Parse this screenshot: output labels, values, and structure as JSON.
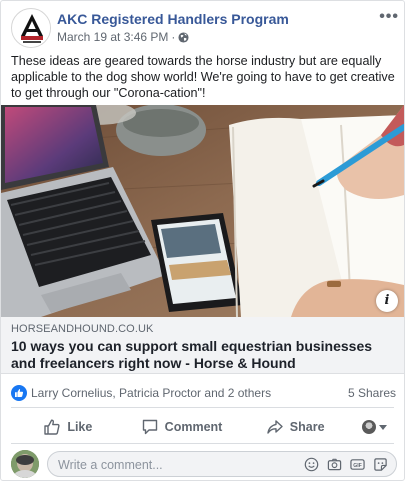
{
  "post": {
    "author": "AKC Registered Handlers Program",
    "timestamp": "March 19 at 3:46 PM",
    "separator": "·",
    "more_label": "•••",
    "text": "These ideas are geared towards the horse industry but are equally applicable to the dog show world! We're going to have to get creative to get through our \"Corona-cation\"!"
  },
  "link": {
    "domain": "HORSEANDHOUND.CO.UK",
    "title": "10 ways you can support small equestrian businesses and freelancers right now - Horse & Hound",
    "info_label": "i"
  },
  "reactions": {
    "names": "Larry Cornelius, Patricia Proctor and 2 others",
    "shares": "5 Shares"
  },
  "actions": {
    "like": "Like",
    "comment": "Comment",
    "share": "Share"
  },
  "comment": {
    "placeholder": "Write a comment..."
  },
  "icons": {
    "avatar": "akc-logo-icon",
    "privacy": "globe-icon",
    "reaction": "like-reaction-icon",
    "like": "thumbs-up-icon",
    "comment": "speech-bubble-icon",
    "share": "share-arrow-icon",
    "comment_tools": [
      "emoji-icon",
      "camera-icon",
      "gif-icon",
      "sticker-icon"
    ]
  },
  "colors": {
    "link_blue": "#385898",
    "like_blue": "#1877f2",
    "muted_text": "#606770",
    "link_box_bg": "#f2f3f5"
  }
}
